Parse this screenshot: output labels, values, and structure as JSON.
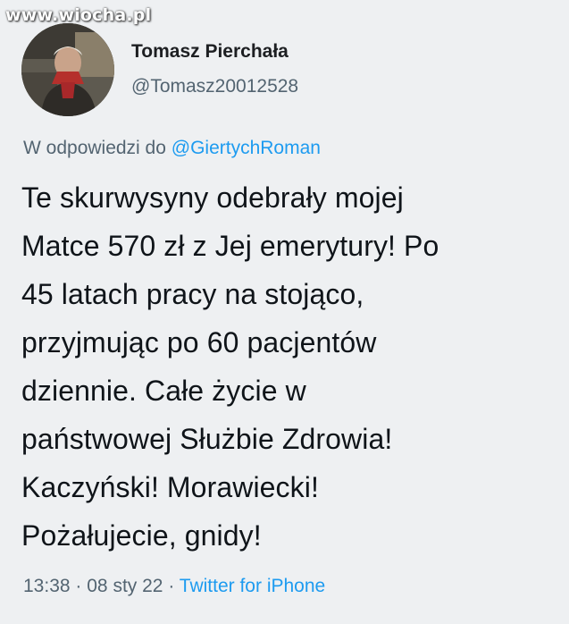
{
  "watermark": "www.wiocha.pl",
  "author": {
    "display_name": "Tomasz Pierchała",
    "handle": "@Tomasz20012528"
  },
  "reply": {
    "prefix": "W odpowiedzi do",
    "mention": "@GiertychRoman"
  },
  "tweet": {
    "lines": [
      "Te skurwysyny odebrały mojej",
      "Matce 570 zł z Jej emerytury! Po",
      "45 latach pracy na stojąco,",
      "przyjmując po 60 pacjentów",
      "dziennie. Całe życie w",
      "państwowej Służbie Zdrowia!",
      "Kaczyński! Morawiecki!",
      "Pożałujecie, gnidy!"
    ]
  },
  "meta": {
    "time": "13:38",
    "separator": "·",
    "date": "08 sty 22",
    "source": "Twitter for iPhone"
  },
  "colors": {
    "background": "#eef0f2",
    "text": "#0f1419",
    "secondary": "#536471",
    "link": "#1d9bf0"
  }
}
